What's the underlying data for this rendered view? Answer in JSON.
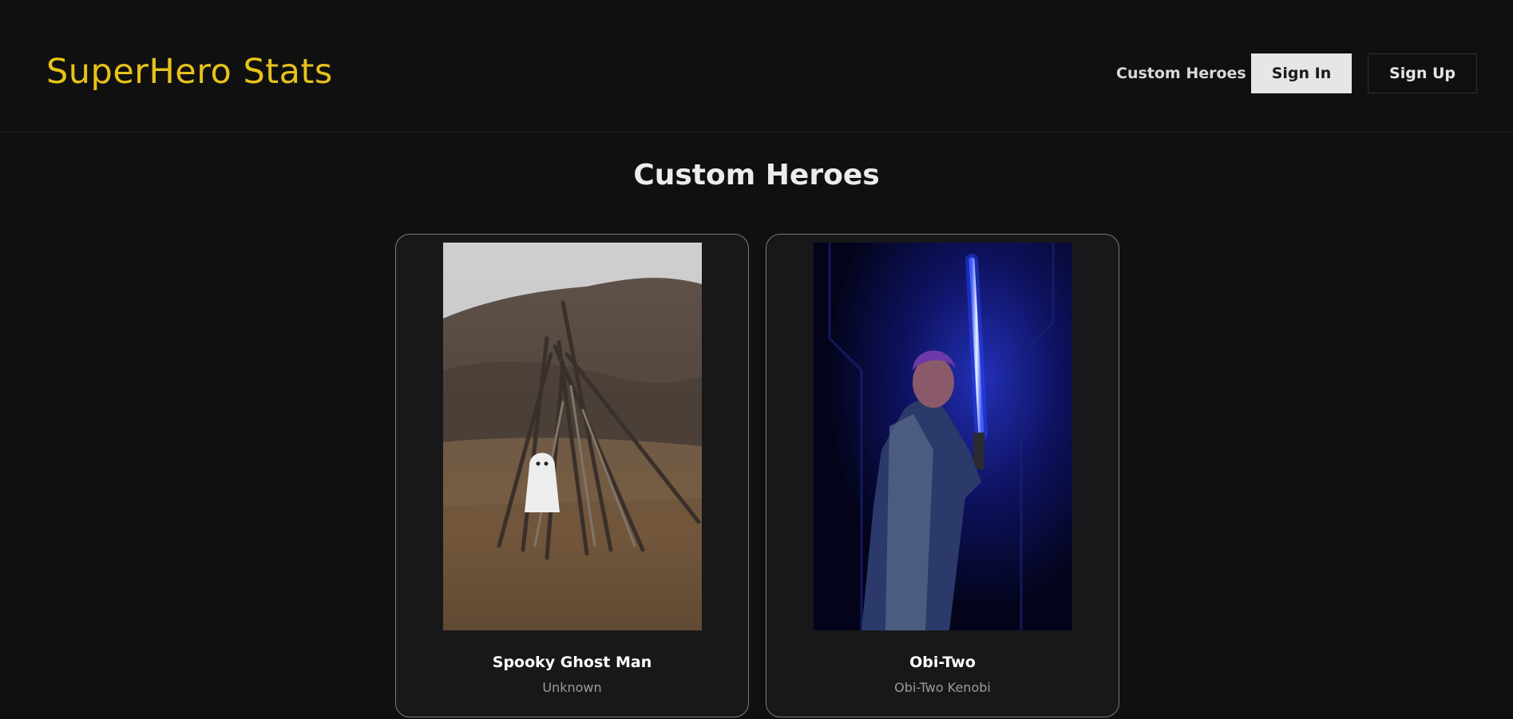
{
  "header": {
    "brand": "SuperHero Stats",
    "nav_custom_heroes": "Custom Heroes",
    "sign_in_label": "Sign In",
    "sign_up_label": "Sign Up"
  },
  "colors": {
    "brand": "#e6c21a",
    "background": "#101010",
    "card_border": "#7a7a7a"
  },
  "main": {
    "title": "Custom Heroes",
    "heroes": [
      {
        "name": "Spooky Ghost Man",
        "real_name": "Unknown",
        "image": "ghost-photo"
      },
      {
        "name": "Obi-Two",
        "real_name": "Obi-Two Kenobi",
        "image": "lightsaber-photo"
      }
    ]
  }
}
